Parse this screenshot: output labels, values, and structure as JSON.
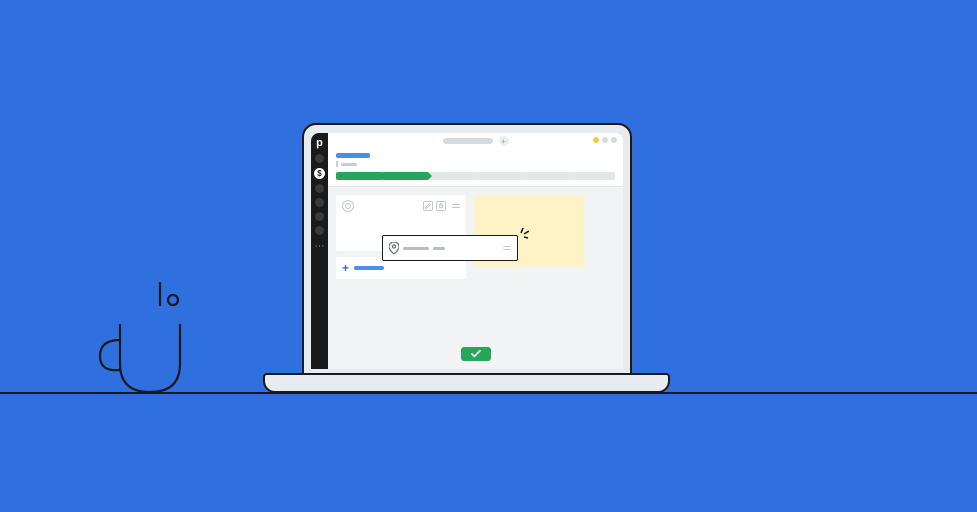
{
  "sidebar": {
    "logo_glyph": "p",
    "active_icon": "dollar-icon",
    "item_count": 6
  },
  "topbar": {
    "address_placeholder": "",
    "new_tab_glyph": "+",
    "window_controls": [
      "minimize",
      "expand",
      "close"
    ]
  },
  "deal": {
    "title_placeholder": "",
    "subtitle_placeholder": "",
    "pipeline": {
      "stages_total": 6,
      "stages_completed": 2
    }
  },
  "panels": {
    "contact_card": {
      "avatar": "person-icon",
      "actions": [
        "edit",
        "delete"
      ]
    },
    "add_card": {
      "glyph": "+",
      "label_placeholder": ""
    },
    "note_panel": {
      "color": "#fdf3c7"
    }
  },
  "floating_card": {
    "icon": "map-pin-icon",
    "line1_placeholder": "",
    "line2_placeholder": ""
  },
  "cta": {
    "icon": "check-icon",
    "color": "#26a65b"
  },
  "decor": {
    "coffee_cup": true
  }
}
